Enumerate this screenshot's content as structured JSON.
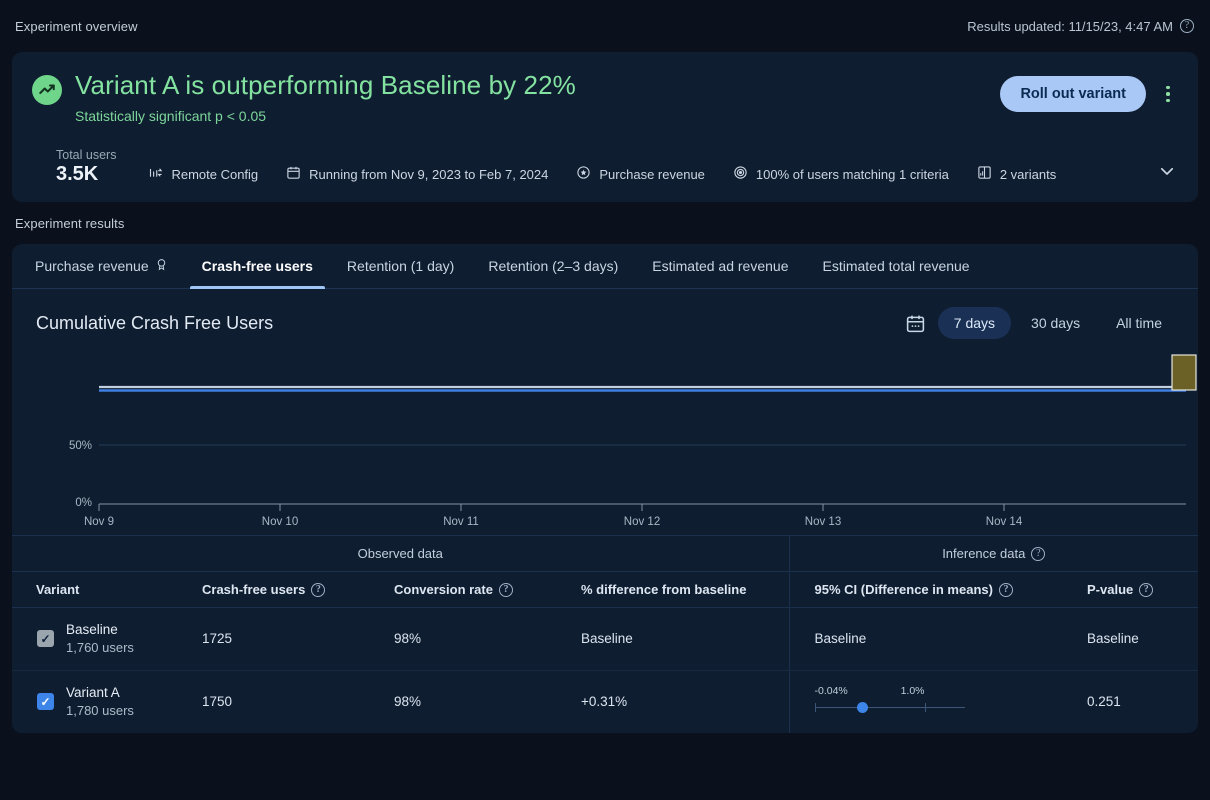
{
  "top": {
    "section_label": "Experiment overview",
    "results_updated": "Results updated: 11/15/23, 4:47 AM",
    "help_glyph": "?"
  },
  "overview": {
    "headline": "Variant A is outperforming Baseline by 22%",
    "subhead": "Statistically significant p < 0.05",
    "rollout_label": "Roll out variant",
    "total_users_label": "Total users",
    "total_users_value": "3.5K",
    "meta": [
      {
        "icon": "remote-config-icon",
        "label": "Remote Config"
      },
      {
        "icon": "calendar-icon",
        "label": "Running from Nov 9, 2023 to Feb 7, 2024"
      },
      {
        "icon": "target-star-icon",
        "label": "Purchase revenue"
      },
      {
        "icon": "target-icon",
        "label": "100% of users matching 1 criteria"
      },
      {
        "icon": "variants-icon",
        "label": "2 variants"
      }
    ]
  },
  "results": {
    "section_label": "Experiment results",
    "tabs": [
      {
        "label": "Purchase revenue",
        "active": false,
        "has_goal_icon": true
      },
      {
        "label": "Crash-free users",
        "active": true,
        "has_goal_icon": false
      },
      {
        "label": "Retention (1 day)",
        "active": false,
        "has_goal_icon": false
      },
      {
        "label": "Retention (2–3 days)",
        "active": false,
        "has_goal_icon": false
      },
      {
        "label": "Estimated ad revenue",
        "active": false,
        "has_goal_icon": false
      },
      {
        "label": "Estimated total revenue",
        "active": false,
        "has_goal_icon": false
      }
    ],
    "chart_title": "Cumulative Crash Free Users",
    "ranges": [
      {
        "label": "7 days",
        "active": true
      },
      {
        "label": "30 days",
        "active": false
      },
      {
        "label": "All time",
        "active": false
      }
    ]
  },
  "chart_data": {
    "type": "line",
    "title": "Cumulative Crash Free Users",
    "xlabel": "",
    "ylabel": "",
    "ylim": [
      0,
      100
    ],
    "ytick_labels": [
      "0%",
      "50%"
    ],
    "ytick_values": [
      0,
      50
    ],
    "grid": true,
    "legend_position": "none",
    "x": [
      "Nov 9",
      "Nov 10",
      "Nov 11",
      "Nov 12",
      "Nov 13",
      "Nov 14"
    ],
    "series": [
      {
        "name": "Baseline",
        "color": "#b9c8dd",
        "values": [
          98,
          98,
          98,
          98,
          98,
          98
        ]
      },
      {
        "name": "Variant A",
        "color": "#3f7fe0",
        "values": [
          98,
          98,
          98,
          98,
          98,
          98
        ]
      }
    ],
    "annotation": {
      "type": "tooltip-marker",
      "color": "#6b6026",
      "x": "Nov 14"
    }
  },
  "table": {
    "group_headers": [
      {
        "label": "Observed data",
        "has_help": false
      },
      {
        "label": "Inference data",
        "has_help": true
      }
    ],
    "columns": [
      {
        "label": "Variant",
        "has_help": false
      },
      {
        "label": "Crash-free users",
        "has_help": true
      },
      {
        "label": "Conversion rate",
        "has_help": true
      },
      {
        "label": "% difference from baseline",
        "has_help": false
      },
      {
        "label": "95% CI (Difference in means)",
        "has_help": true
      },
      {
        "label": "P-value",
        "has_help": true
      }
    ],
    "rows": [
      {
        "checkbox": "gray",
        "check_glyph": "✓",
        "variant": "Baseline",
        "users": "1,760 users",
        "crash_free_users": "1725",
        "conversion_rate": "98%",
        "difference": "Baseline",
        "difference_muted": true,
        "ci_text": "Baseline",
        "ci_muted": true,
        "has_ci_chart": false,
        "p_value": "Baseline",
        "p_muted": true
      },
      {
        "checkbox": "blue",
        "check_glyph": "✓",
        "variant": "Variant A",
        "users": "1,780 users",
        "crash_free_users": "1750",
        "conversion_rate": "98%",
        "difference": "+0.31%",
        "difference_muted": false,
        "ci_low": "-0.04%",
        "ci_high": "1.0%",
        "ci_muted": false,
        "has_ci_chart": true,
        "p_value": "0.251",
        "p_muted": false
      }
    ]
  },
  "colors": {
    "page_bg": "#0a111c",
    "card_bg": "#0e1d30",
    "accent_green": "#84e2a0",
    "accent_blue": "#a9c8f5",
    "line_blue": "#3f7fe0"
  }
}
